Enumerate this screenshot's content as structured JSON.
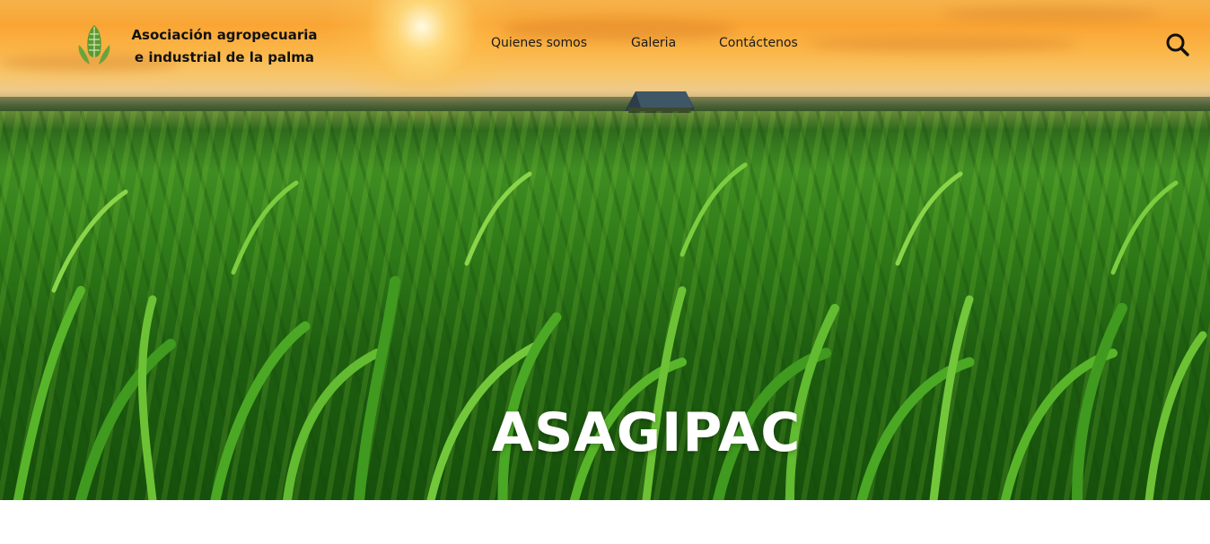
{
  "header": {
    "logo_icon": "corn-cob-icon",
    "brand_line1": "Asociación agropecuaria",
    "brand_line2": "e industrial de la palma",
    "nav": [
      {
        "label": "Quienes somos"
      },
      {
        "label": "Galeria"
      },
      {
        "label": "Contáctenos"
      }
    ],
    "search_icon": "search-icon"
  },
  "hero": {
    "title": "ASAGIPAC",
    "background": "corn-field-at-sunset"
  },
  "colors": {
    "sky_orange": "#f9a534",
    "field_green": "#2f7a18",
    "logo_green": "#6aa33a",
    "text_dark": "#111111",
    "title_white": "#ffffff"
  }
}
